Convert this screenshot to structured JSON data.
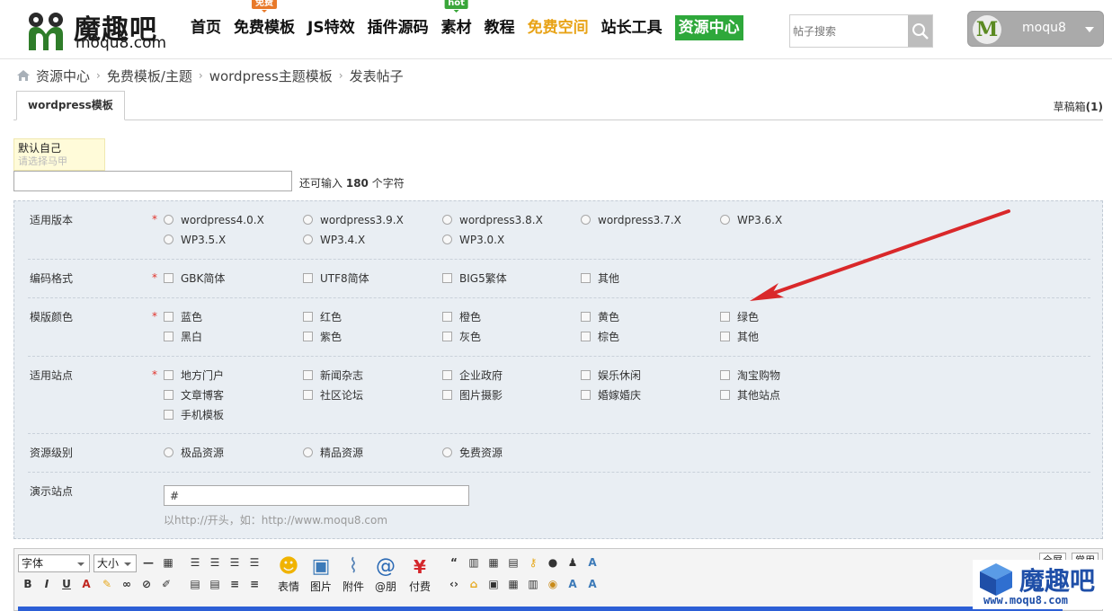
{
  "header": {
    "logo_cn": "魔趣吧",
    "logo_en": "moqu8.com",
    "nav": [
      {
        "label": "首页"
      },
      {
        "label": "免费模板",
        "badge": "免费"
      },
      {
        "label": "JS特效"
      },
      {
        "label": "插件源码"
      },
      {
        "label": "素材",
        "badge": "hot"
      },
      {
        "label": "教程"
      },
      {
        "label": "免费空间"
      },
      {
        "label": "站长工具"
      },
      {
        "label": "资源中心"
      }
    ],
    "search_placeholder": "帖子搜索",
    "user": {
      "avatar_letter": "M",
      "name": "moqu8"
    }
  },
  "breadcrumb": [
    "资源中心",
    "免费模板/主题",
    "wordpress主题模板",
    "发表帖子"
  ],
  "tabs": {
    "active": "wordpress模板",
    "drafts_label": "草稿箱",
    "drafts_count": "(1)"
  },
  "alias": {
    "name": "默认自己",
    "hint": "请选择马甲"
  },
  "title": {
    "count_prefix": "还可输入",
    "count": "180",
    "count_suffix": "个字符"
  },
  "form": {
    "version": {
      "label": "适用版本",
      "options": [
        "wordpress4.0.X",
        "wordpress3.9.X",
        "wordpress3.8.X",
        "wordpress3.7.X",
        "WP3.6.X",
        "WP3.5.X",
        "WP3.4.X",
        "WP3.0.X"
      ]
    },
    "encoding": {
      "label": "编码格式",
      "options": [
        "GBK简体",
        "UTF8简体",
        "BIG5繁体",
        "其他"
      ]
    },
    "color": {
      "label": "模版颜色",
      "options": [
        "蓝色",
        "红色",
        "橙色",
        "黄色",
        "绿色",
        "黑白",
        "紫色",
        "灰色",
        "棕色",
        "其他"
      ]
    },
    "site": {
      "label": "适用站点",
      "options": [
        "地方门户",
        "新闻杂志",
        "企业政府",
        "娱乐休闲",
        "淘宝购物",
        "文章博客",
        "社区论坛",
        "图片摄影",
        "婚嫁婚庆",
        "其他站点",
        "手机模板"
      ]
    },
    "level": {
      "label": "资源级别",
      "options": [
        "极品资源",
        "精品资源",
        "免费资源"
      ]
    },
    "demo": {
      "label": "演示站点",
      "value": "#",
      "hint": "以http://开头，如：http://www.moqu8.com"
    },
    "required_mark": "*"
  },
  "editor": {
    "font_label": "字体",
    "size_label": "大小",
    "buttons": [
      "表情",
      "图片",
      "附件",
      "@朋",
      "付费"
    ],
    "format_buttons": [
      "B",
      "I",
      "U",
      "A"
    ],
    "mode_buttons": [
      "全屏",
      "常用"
    ]
  },
  "watermark": {
    "cn": "魔趣吧",
    "en": "www.moqu8.com"
  },
  "colors": {
    "accent_green": "#2ea83b",
    "accent_gold": "#e8a317",
    "required_red": "#e1322b",
    "panel_bg": "#e9eef3",
    "arrow_red": "#d9282a",
    "editor_blue": "#2c5fd6"
  }
}
